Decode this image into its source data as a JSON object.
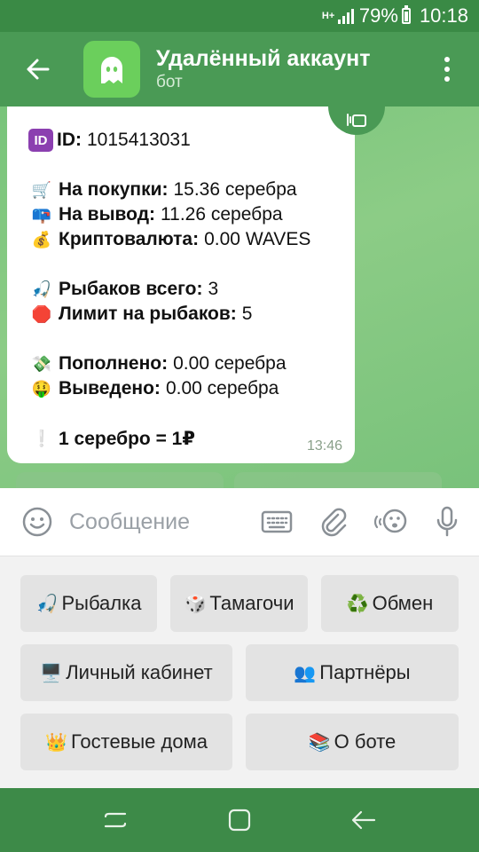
{
  "status_bar": {
    "network": "H+",
    "battery": "79%",
    "time": "10:18"
  },
  "header": {
    "title": "Удалённый аккаунт",
    "subtitle": "бот"
  },
  "message": {
    "id_label": "ID:",
    "id_value": "1015413031",
    "purchases_label": "На покупки:",
    "purchases_value": "15.36 серебра",
    "withdraw_label": "На вывод:",
    "withdraw_value": "11.26 серебра",
    "crypto_label": "Криптовалюта:",
    "crypto_value": "0.00 WAVES",
    "fishers_total_label": "Рыбаков всего:",
    "fishers_total_value": "3",
    "fishers_limit_label": "Лимит на рыбаков:",
    "fishers_limit_value": "5",
    "deposited_label": "Пополнено:",
    "deposited_value": "0.00 серебра",
    "withdrawn_label": "Выведено:",
    "withdrawn_value": "0.00 серебра",
    "rate": "1 серебро = 1₽",
    "time": "13:46"
  },
  "input": {
    "placeholder": "Сообщение"
  },
  "keyboard": {
    "fishing": {
      "emoji": "🎣",
      "label": "Рыбалка"
    },
    "tamagotchi": {
      "emoji": "🎲",
      "label": "Тамагочи"
    },
    "exchange": {
      "emoji": "♻️",
      "label": "Обмен"
    },
    "cabinet": {
      "emoji": "🖥️",
      "label": "Личный кабинет"
    },
    "partners": {
      "emoji": "👥",
      "label": "Партнёры"
    },
    "guest_houses": {
      "emoji": "👑",
      "label": "Гостевые дома"
    },
    "about": {
      "emoji": "📚",
      "label": "О боте"
    }
  },
  "icons": {
    "purchases": "shopping-cart-icon",
    "withdraw": "mailbox-icon",
    "crypto": "money-bag-icon",
    "fishers": "fishing-pole-icon",
    "limit": "stop-sign-icon",
    "deposited": "money-wings-icon",
    "withdrawn": "money-mouth-face-icon",
    "rate": "exclamation-icon"
  },
  "colors": {
    "header": "#4a9a55",
    "status_bar": "#3a8a45",
    "accent": "#6bcf5c"
  }
}
